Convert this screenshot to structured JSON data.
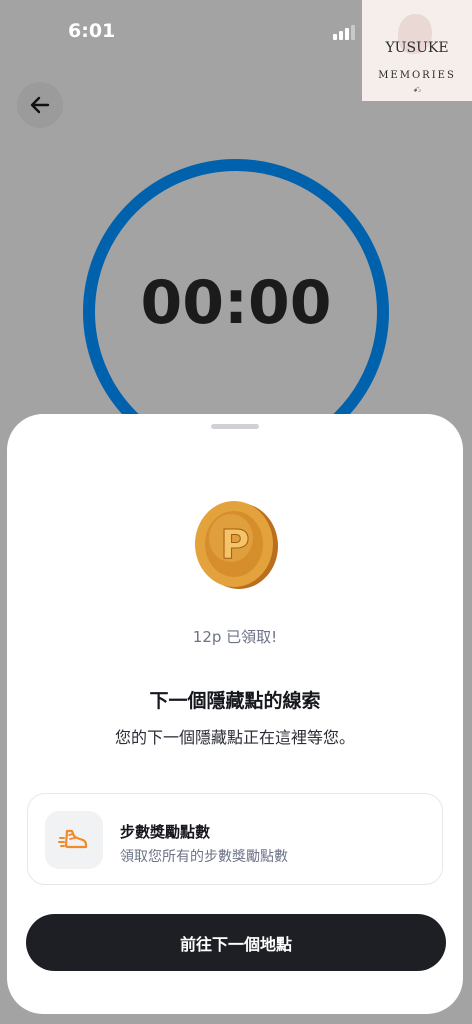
{
  "status_bar": {
    "time": "6:01"
  },
  "watermark": {
    "title": "YUSUKE",
    "subtitle": "MEMORIES",
    "signature": "ꗃ₂"
  },
  "timer": {
    "display": "00:00",
    "ring_color": "#0061ad"
  },
  "sheet": {
    "reward_text": "12p 已領取!",
    "coin_letter": "P",
    "clue_title": "下一個隱藏點的線索",
    "clue_description": "您的下一個隱藏點正在這裡等您。",
    "step_card": {
      "title": "步數獎勵點數",
      "subtitle": "領取您所有的步數獎勵點數",
      "icon": "running-shoe-icon"
    },
    "next_button_label": "前往下一個地點"
  },
  "colors": {
    "backdrop": "#a3a3a3",
    "accent_ring": "#0061ad",
    "coin": "#e3a23c",
    "button": "#1e1f24",
    "shoe_icon": "#f08a2c"
  }
}
